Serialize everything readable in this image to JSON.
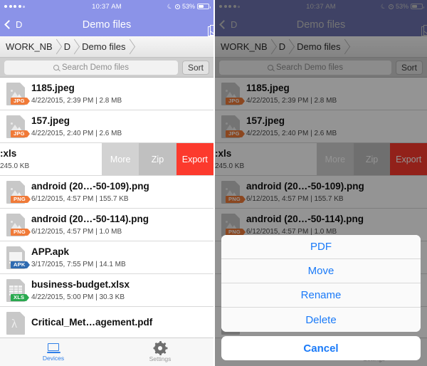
{
  "status_bar": {
    "time": "10:37 AM",
    "battery_percent": "53%",
    "signal_dots_filled": 4,
    "signal_dots_total": 5,
    "moon_icon": "moon-icon",
    "alarm_icon": "alarm-clock-icon",
    "battery_icon": "battery-icon"
  },
  "nav_bar": {
    "back_label": "D",
    "back_icon": "chevron-left-icon",
    "title": "Demo files",
    "select_icon": "checklist-select-icon"
  },
  "breadcrumb": {
    "items": [
      {
        "label": "WORK_NB"
      },
      {
        "label": "D"
      },
      {
        "label": "Demo files"
      }
    ]
  },
  "search": {
    "placeholder": "Search Demo files",
    "value": "",
    "icon": "search-icon",
    "sort_label": "Sort"
  },
  "files": [
    {
      "name": "1185.jpeg",
      "meta": "4/22/2015, 2:39 PM | 2.8 MB",
      "badge": "JPG",
      "kind": "image",
      "badge_color": "#f07a38"
    },
    {
      "name": "157.jpeg",
      "meta": "4/22/2015, 2:40 PM | 2.6 MB",
      "badge": "JPG",
      "kind": "image",
      "badge_color": "#f07a38"
    },
    {
      "name": "android (20…-50-109).png",
      "meta": "6/12/2015, 4:57 PM | 155.7 KB",
      "badge": "PNG",
      "kind": "image",
      "badge_color": "#f07a38"
    },
    {
      "name": "android (20…-50-114).png",
      "meta": "6/12/2015, 4:57 PM | 1.0 MB",
      "badge": "PNG",
      "kind": "image",
      "badge_color": "#f07a38"
    },
    {
      "name": "APP.apk",
      "meta": "3/17/2015, 7:55 PM | 14.1 MB",
      "badge": "APK",
      "kind": "apk",
      "badge_color": "#2e6ab0"
    },
    {
      "name": "business-budget.xlsx",
      "meta": "4/22/2015, 5:00 PM | 30.3 KB",
      "badge": "XLS",
      "kind": "spreadsheet",
      "badge_color": "#2aa94f"
    },
    {
      "name": "Critical_Met…agement.pdf",
      "meta": "",
      "badge": "PDF",
      "kind": "pdf",
      "badge_color": "#d13b31"
    }
  ],
  "swiped_row": {
    "name": ":xls",
    "meta": "245.0 KB",
    "actions": [
      {
        "label": "More",
        "color": "#d2d2d2"
      },
      {
        "label": "Zip",
        "color": "#c0c0c0"
      },
      {
        "label": "Export",
        "color": "#fc3a2d"
      }
    ]
  },
  "tab_bar": {
    "tabs": [
      {
        "label": "Devices",
        "icon": "laptop-icon",
        "active": true,
        "color": "#2f7fe8"
      },
      {
        "label": "Settings",
        "icon": "gear-icon",
        "active": false,
        "color": "#9a9a9a"
      }
    ]
  },
  "action_sheet": {
    "items": [
      {
        "label": "PDF"
      },
      {
        "label": "Move"
      },
      {
        "label": "Rename"
      },
      {
        "label": "Delete"
      }
    ],
    "cancel_label": "Cancel",
    "tint_color": "#1a7af8"
  },
  "theme": {
    "nav_bar_color": "#8b93e8",
    "search_bar_color": "#cfcfcf",
    "export_red": "#fc3a2d",
    "accent_blue": "#2f7fe8"
  }
}
